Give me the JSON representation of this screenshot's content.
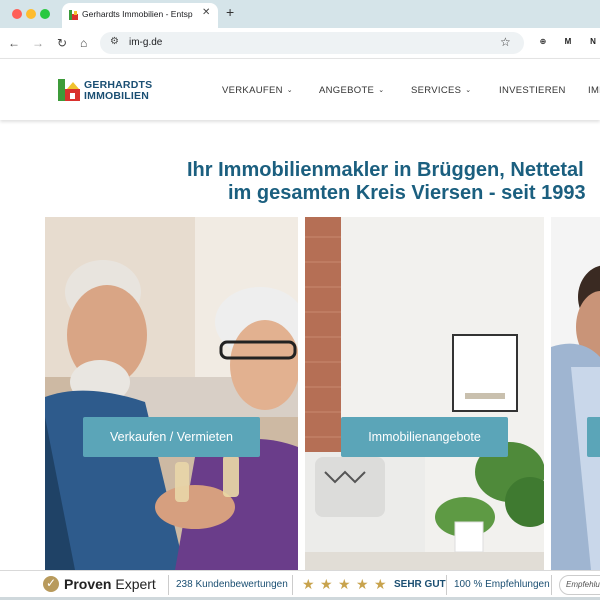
{
  "browser": {
    "tab_title": "Gerhardts Immobilien - Entsp",
    "close_glyph": "✕",
    "new_tab_glyph": "+",
    "url": "im-g.de",
    "nav": {
      "back": "←",
      "forward": "→",
      "reload": "↻",
      "home": "⌂"
    },
    "star_glyph": "☆",
    "extensions": [
      "⊕",
      "M",
      "N"
    ]
  },
  "site": {
    "logo": {
      "line1": "GERHARDTS",
      "line2": "IMMOBILIEN"
    },
    "menu": [
      {
        "label": "VERKAUFEN",
        "has_dropdown": true
      },
      {
        "label": "ANGEBOTE",
        "has_dropdown": true
      },
      {
        "label": "SERVICES",
        "has_dropdown": true
      },
      {
        "label": "INVESTIEREN",
        "has_dropdown": false
      },
      {
        "label": "IMMO",
        "has_dropdown": false
      }
    ],
    "chevron": "⌄"
  },
  "hero": {
    "line1": "Ihr Immobilienmakler in Brüggen, Nettetal",
    "line2": "im gesamten Kreis Viersen - seit 1993"
  },
  "panels": [
    {
      "button": "Verkaufen / Vermieten"
    },
    {
      "button": "Immobilienangebote"
    },
    {
      "button": ""
    }
  ],
  "proven_expert": {
    "brand_a": "Proven",
    "brand_b": "Expert",
    "reviews": "238 Kundenbewertungen",
    "stars": 5,
    "rating_label": "SEHR GUT",
    "recommend": "100 % Empfehlungen",
    "pill": "Empfehlungen"
  },
  "colors": {
    "brand_blue": "#1b5f7f",
    "button": "#5ba5b8",
    "tab_strip": "#d5e4e9",
    "star_gold": "#c8a34d"
  }
}
